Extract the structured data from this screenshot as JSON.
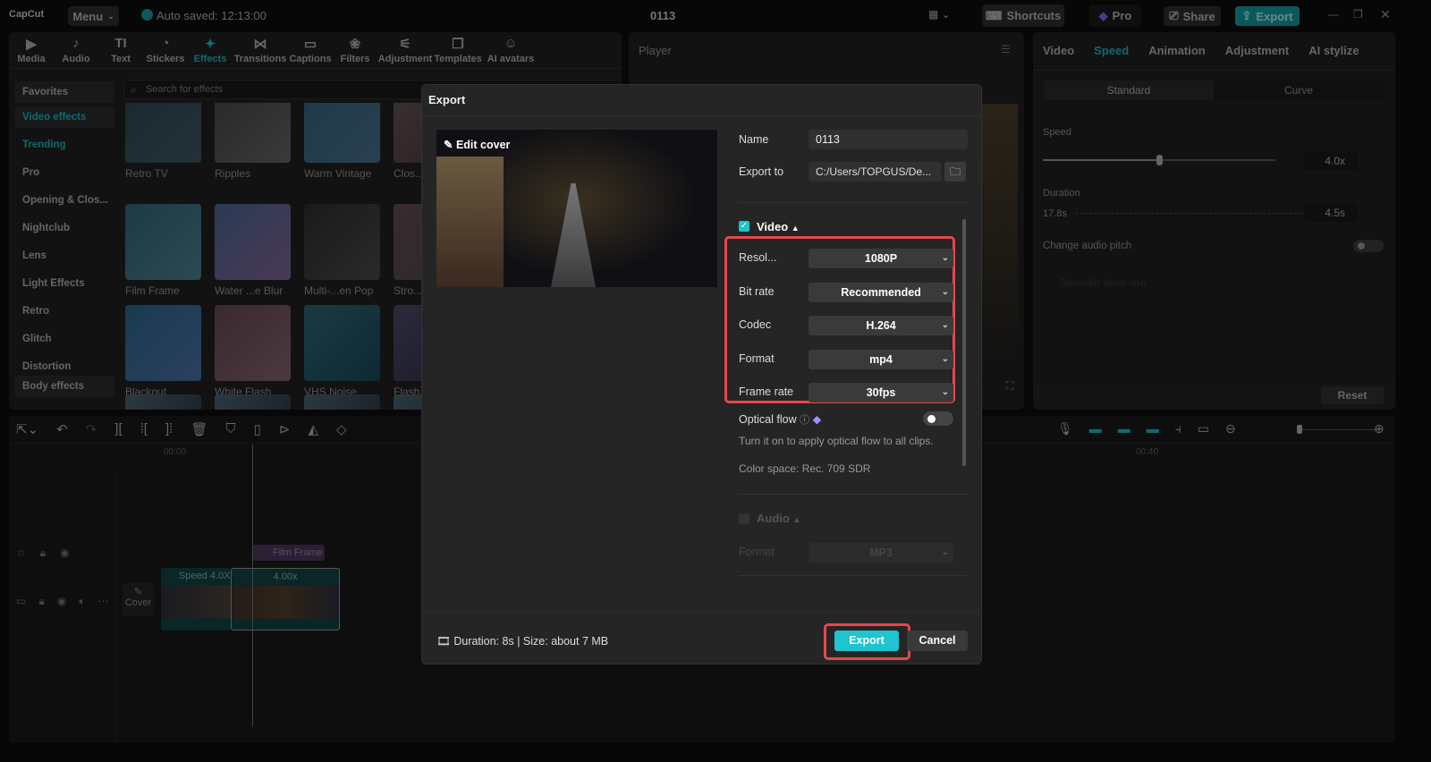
{
  "topbar": {
    "logo": "CapCut",
    "menu": "Menu",
    "autosave": "Auto saved: 12:13:00",
    "project_title": "0113",
    "shortcuts": "Shortcuts",
    "pro": "Pro",
    "share": "Share",
    "export": "Export"
  },
  "media_tabs": [
    {
      "label": "Media",
      "icon": "▶"
    },
    {
      "label": "Audio",
      "icon": "♪"
    },
    {
      "label": "Text",
      "icon": "TI"
    },
    {
      "label": "Stickers",
      "icon": "◔"
    },
    {
      "label": "Effects",
      "icon": "✦"
    },
    {
      "label": "Transitions",
      "icon": "⋈"
    },
    {
      "label": "Captions",
      "icon": "▭"
    },
    {
      "label": "Filters",
      "icon": "❀"
    },
    {
      "label": "Adjustment",
      "icon": "⚟"
    },
    {
      "label": "Templates",
      "icon": "❐"
    },
    {
      "label": "AI avatars",
      "icon": "☺"
    }
  ],
  "effects": {
    "search_placeholder": "Search for effects",
    "categories": [
      "Favorites",
      "Video effects",
      "Trending",
      "Pro",
      "Opening & Clos...",
      "Nightclub",
      "Lens",
      "Light Effects",
      "Retro",
      "Glitch",
      "Distortion",
      "Body effects"
    ],
    "items": [
      "Retro TV",
      "Ripples",
      "Warm Vintage",
      "Clos...",
      "Film Frame",
      "Water ...e Blur",
      "Multi-...en Pop",
      "Stro...",
      "Blackout",
      "White Flash",
      "VHS Noise",
      "Flash"
    ]
  },
  "player": {
    "title": "Player"
  },
  "right_panel": {
    "tabs": [
      "Video",
      "Speed",
      "Animation",
      "Adjustment",
      "AI stylize"
    ],
    "modes": [
      "Standard",
      "Curve"
    ],
    "speed_label": "Speed",
    "speed_value": "4.0x",
    "speed_fraction": 0.5,
    "duration_label": "Duration",
    "duration_from": "17.8s",
    "duration_to": "4.5s",
    "pitch_label": "Change audio pitch",
    "smooth_label": "Smooth slow-mo",
    "reset": "Reset"
  },
  "timeline": {
    "times": [
      "00:00",
      "00:40"
    ],
    "effect_clip": "Film Frame",
    "clip1": "Speed 4.0X",
    "clip2": "4.00x",
    "cover": "Cover"
  },
  "export_dialog": {
    "title": "Export",
    "edit_cover": "Edit cover",
    "name_label": "Name",
    "name_value": "0113",
    "export_to_label": "Export to",
    "export_to_value": "C:/Users/TOPGUS/De...",
    "video_section": "Video",
    "fields": [
      {
        "label": "Resol...",
        "value": "1080P"
      },
      {
        "label": "Bit rate",
        "value": "Recommended"
      },
      {
        "label": "Codec",
        "value": "H.264"
      },
      {
        "label": "Format",
        "value": "mp4"
      },
      {
        "label": "Frame rate",
        "value": "30fps"
      }
    ],
    "optical_flow": "Optical flow",
    "optical_flow_hint": "Turn it on to apply optical flow to all clips.",
    "color_space": "Color space: Rec. 709 SDR",
    "audio_section": "Audio",
    "audio_format_label": "Format",
    "audio_format_value": "MP3",
    "summary": "Duration: 8s | Size: about 7 MB",
    "export_button": "Export",
    "cancel_button": "Cancel"
  },
  "colors": {
    "accent": "#1ec4cf",
    "highlight": "#e5484d"
  }
}
